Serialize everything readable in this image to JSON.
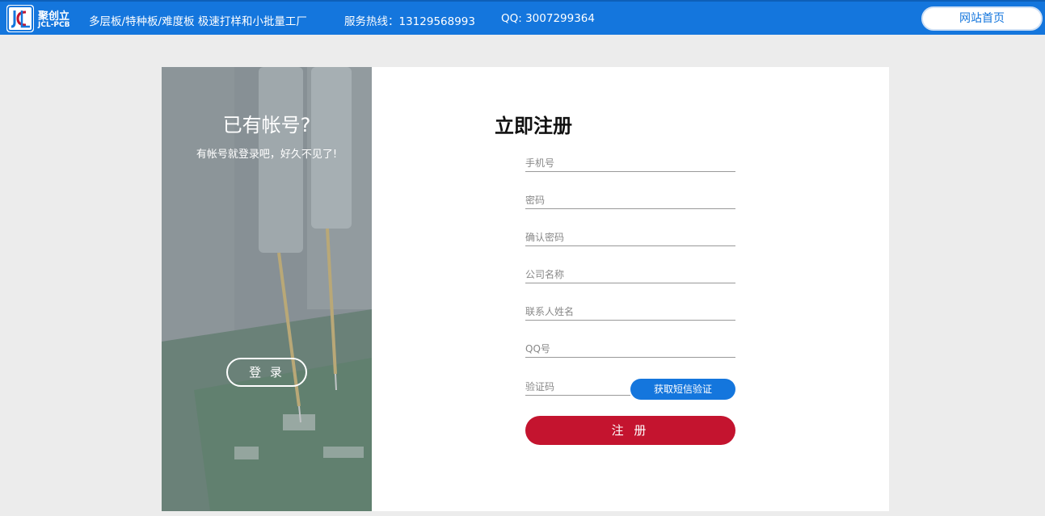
{
  "header": {
    "logo_cn": "聚创立",
    "logo_en": "JCL-PCB",
    "slogan": "多层板/特种板/难度板 极速打样和小批量工厂",
    "hotline": "服务热线：13129568993",
    "qq": "QQ: 3007299364",
    "home_label": "网站首页"
  },
  "side": {
    "title": "已有帐号?",
    "subtitle": "有帐号就登录吧，好久不见了!",
    "login_label": "登 录"
  },
  "form": {
    "title": "立即注册",
    "phone_placeholder": "手机号",
    "password_placeholder": "密码",
    "confirm_placeholder": "确认密码",
    "company_placeholder": "公司名称",
    "contact_placeholder": "联系人姓名",
    "qq_placeholder": "QQ号",
    "code_placeholder": "验证码",
    "sms_label": "获取短信验证",
    "register_label": "注 册"
  },
  "colors": {
    "header_bg": "#1476dd",
    "register_button": "#c4142f",
    "sms_button": "#1476dd",
    "page_bg": "#ececec"
  }
}
